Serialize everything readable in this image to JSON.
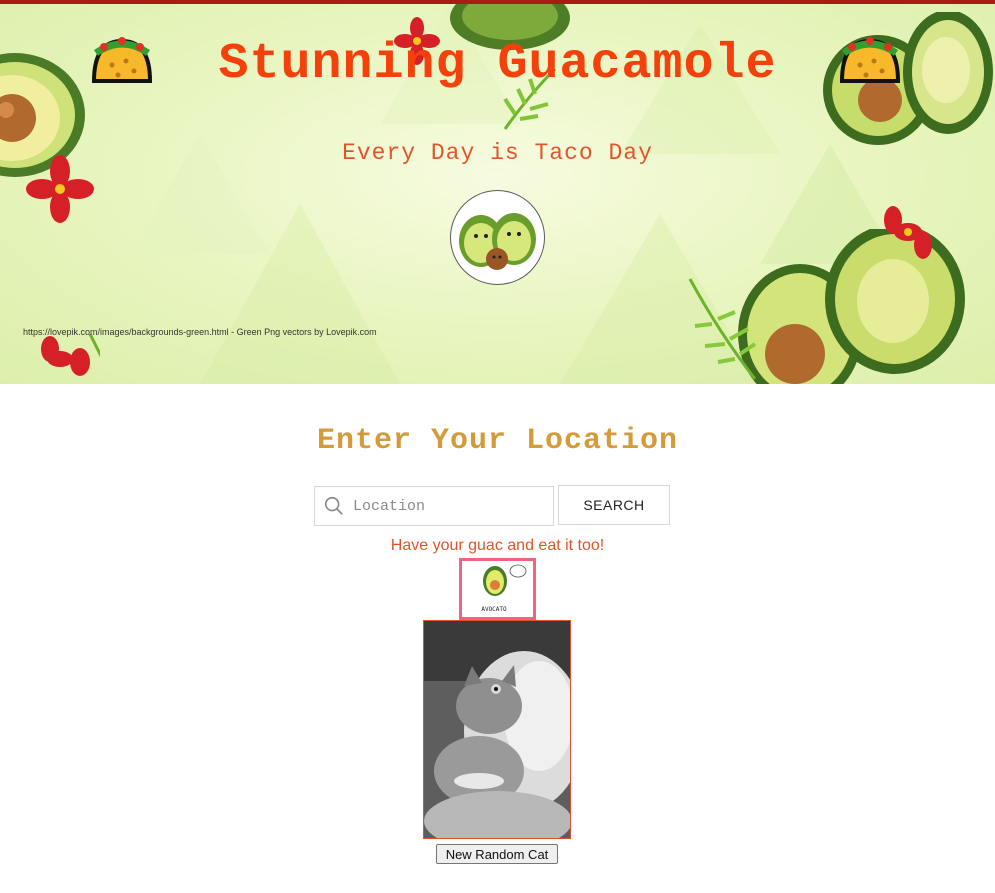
{
  "header": {
    "title": "Stunning Guacamole",
    "tagline": "Every Day is Taco Day",
    "credit": "https://lovepik.com/images/backgrounds-green.html - Green Png vectors by Lovepik.com",
    "left_icon": "taco-icon",
    "right_icon": "taco-icon",
    "logo": "avocado-couple-logo"
  },
  "location": {
    "heading": "Enter Your Location",
    "placeholder": "Location",
    "value": "",
    "search_label": "SEARCH",
    "search_icon": "search-icon"
  },
  "promo": {
    "message": "Have your guac and eat it too!",
    "avocato_icon": "avocato-icon",
    "avocato_text": "AVOCATO"
  },
  "cat": {
    "button_label": "New Random Cat"
  },
  "colors": {
    "title": "#f4410b",
    "tagline": "#e2552a",
    "heading": "#d49b3a",
    "accent_border": "#f06480",
    "top_strip": "#a81c12"
  }
}
